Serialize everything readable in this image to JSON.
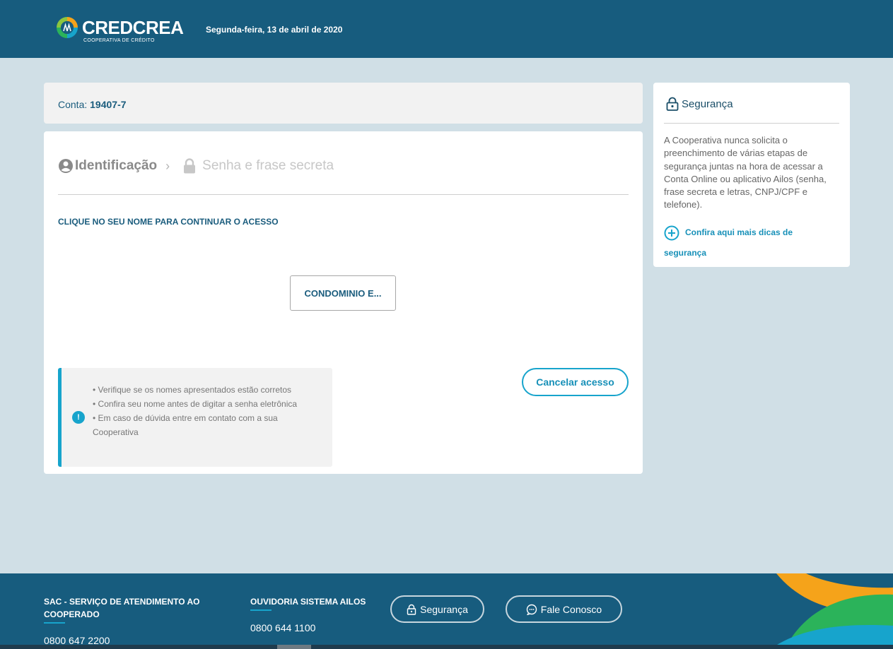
{
  "header": {
    "logo_text": "CREDCREA",
    "logo_subtitle": "COOPERATIVA DE CRÉDITO",
    "date": "Segunda-feira, 13 de abril de 2020"
  },
  "account": {
    "label": "Conta:",
    "number": "19407-7"
  },
  "steps": {
    "step1": "Identificação",
    "separator": "›",
    "step2": "Senha e frase secreta"
  },
  "main": {
    "instruction": "CLIQUE NO SEU NOME PARA CONTINUAR O ACESSO",
    "name_button": "CONDOMINIO E...",
    "tips": [
      "• Verifique se os nomes apresentados estão corretos",
      "• Confira seu nome antes de digitar a senha eletrônica",
      "• Em caso de dúvida entre em contato com a sua Cooperativa"
    ],
    "tips_icon": "!",
    "cancel_button": "Cancelar acesso"
  },
  "security": {
    "title": "Segurança",
    "text": "A Cooperativa nunca solicita o preenchimento de várias etapas de segurança juntas na hora de acessar a Conta Online ou aplicativo Ailos (senha, frase secreta e letras, CNPJ/CPF e telefone).",
    "link": "Confira aqui mais dicas de segurança"
  },
  "footer": {
    "sac_title": "SAC - SERVIÇO DE ATENDIMENTO AO COOPERADO",
    "sac_phone": "0800 647 2200",
    "ouvidoria_title": "OUVIDORIA SISTEMA AILOS",
    "ouvidoria_phone": "0800 644 1100",
    "security_button": "Segurança",
    "contact_button": "Fale Conosco"
  },
  "colors": {
    "header_bg": "#175c7e",
    "page_bg": "#d0dfe6",
    "accent": "#17a4cc",
    "text_dark": "#1a5c7d"
  },
  "icons": [
    "logo-icon",
    "user-circle-icon",
    "lock-icon",
    "info-icon",
    "padlock-icon",
    "plus-circle-icon",
    "chat-icon"
  ]
}
